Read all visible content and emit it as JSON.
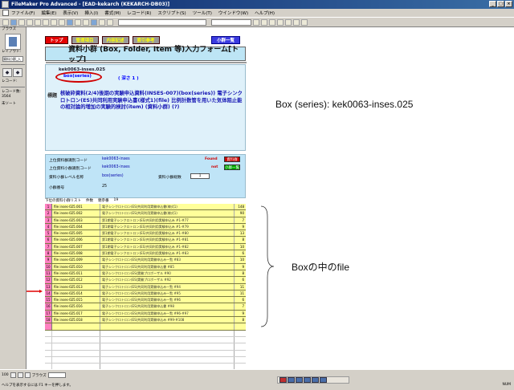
{
  "window": {
    "title": "FileMaker Pro Advanced - [EAD-kekarch (KEKARCH-DB03)]",
    "buttons": [
      "_",
      "□",
      "×"
    ]
  },
  "menu": [
    "ファイル(F)",
    "編集(E)",
    "表示(V)",
    "挿入(I)",
    "書式(M)",
    "レコード(R)",
    "スクリプト(S)",
    "ツール(T)",
    "ウインドウ(W)",
    "ヘルプ(H)"
  ],
  "left_panel": {
    "label_browse": "ブラウズ",
    "label_layout": "レイアウト:",
    "layout_select": "資料小群_入",
    "label_record": "レコード:",
    "label_total": "レコード数:",
    "label_sort": "未ソート",
    "nav_prev": "◆",
    "nav_next": "◆",
    "record_count": "3564"
  },
  "form": {
    "nav_buttons": [
      "トップ",
      "管理項目",
      "内容記述",
      "索引参考"
    ],
    "list_button": "小群一覧",
    "page_title": "資料小群 (Box, Folder, Item 等)入力フォーム[トップ]",
    "code": "kek0063-inses.025",
    "series_label": "box(series)",
    "depth": "( 深さ  1  )",
    "hierarchy_label": "標題",
    "hierarchy_text": "核破砕資料(2/4)後期の実験申込資料(INSES-007)(box(series))   電子シンクロトロン(ES)共同利用実験申込書(様式1)(file)   比例計数管を用いた気体阻止能の相対論的増加の実験的検討(item)   (資料小群)   (?)"
  },
  "fields": {
    "upper_code_label": "上位資料群識別コード",
    "upper_code_value": "kek0063-inses",
    "found": "Found",
    "upper_btn": "資料群",
    "upper_small_label": "上位資料小群識別コード",
    "upper_small_value": "kek0063-inses",
    "not_found": "not",
    "upper_small_btn": "小群一覧",
    "level_label": "資料小群レベル名称",
    "level_value": "box(series)",
    "count_label": "資料小群総数",
    "count_value": "1",
    "order_label": "小群番号",
    "order_value": "25"
  },
  "list": {
    "header": [
      "下位の資料小群リスト",
      "件数",
      "親参番",
      "19"
    ],
    "rows": [
      {
        "n": "1",
        "id": "file  inses-025.001",
        "title": "電子シンクロトロン(ES)共同利用実験申込書(様式1)",
        "c": "148"
      },
      {
        "n": "2",
        "id": "file  inses-025.002",
        "title": "電子シンクロトロン(ES)共同利用実験申込書(様式1)",
        "c": "90"
      },
      {
        "n": "3",
        "id": "file  inses-025.003",
        "title": "第1期電子シンクロトロン(ES)共同利用実験申込み #1-#77",
        "c": "7"
      },
      {
        "n": "4",
        "id": "file  inses-025.004",
        "title": "第1期電子シンクロトロン(ES)共同利用実験申込み #1-#79",
        "c": "9"
      },
      {
        "n": "5",
        "id": "file  inses-025.005",
        "title": "第1期電子シンクロトロン(ES)共同利用実験申込み #1-#80",
        "c": "13"
      },
      {
        "n": "6",
        "id": "file  inses-025.006",
        "title": "第1期電子シンクロトロン(ES)共同利用実験申込み #1-#81",
        "c": "8"
      },
      {
        "n": "7",
        "id": "file  inses-025.007",
        "title": "第1期電子シンクロトロン(ES)共同利用実験申込み #1-#82",
        "c": "10"
      },
      {
        "n": "8",
        "id": "file  inses-025.008",
        "title": "第1期電子シンクロトロン(ES)共同利用実験申込み #1-#83",
        "c": "6"
      },
      {
        "n": "9",
        "id": "file  inses-025.009",
        "title": "電子シンクロトロン(ES)共同利用実験申込み一覧 #83",
        "c": "10"
      },
      {
        "n": "10",
        "id": "file  inses-025.010",
        "title": "電子シンクロトロン(ES)共同利用実験申込書 #85",
        "c": "9"
      },
      {
        "n": "11",
        "id": "file  inses-025.011",
        "title": "電子シンクロトロン(ES)実験プロポーザル #90",
        "c": "8"
      },
      {
        "n": "12",
        "id": "file  inses-025.012",
        "title": "電子シンクロトロン(ES)実験プロポーザル #92",
        "c": "6"
      },
      {
        "n": "13",
        "id": "file  inses-025.013",
        "title": "電子シンクロトロン(ES)共同利用実験申込み一覧 #94",
        "c": "11"
      },
      {
        "n": "14",
        "id": "file  inses-025.014",
        "title": "電子シンクロトロン(ES)共同利用実験申込み一覧 #95",
        "c": "11"
      },
      {
        "n": "15",
        "id": "file  inses-025.015",
        "title": "電子シンクロトロン(ES)共同利用実験申込み一覧 #96",
        "c": "6"
      },
      {
        "n": "16",
        "id": "file  inses-025.016",
        "title": "電子シンクロトロン(ES)共同利用実験申込書 #98",
        "c": "7"
      },
      {
        "n": "17",
        "id": "file  inses-025.017",
        "title": "電子シンクロトロン(ES)共同利用実験申込み一覧 #96-#97",
        "c": "9"
      },
      {
        "n": "18",
        "id": "file  inses-025.018",
        "title": "電子シンクロトロン(ES)共同利用実験申込み #99-#108",
        "c": "8"
      }
    ]
  },
  "annotations": {
    "series_note": "Box (series): kek0063-inses.025",
    "file_note": "Boxの中のfile"
  },
  "status": {
    "zoom": "100",
    "mode": "ブラウズ",
    "help": "ヘルプを表示するには F1 キーを押します。",
    "caps": "NUM"
  },
  "colors": {
    "accent_red": "#e30000",
    "title_blue": "#bde5f5",
    "list_yellow": "#ffff9a",
    "annotation_red": "#d00000"
  }
}
